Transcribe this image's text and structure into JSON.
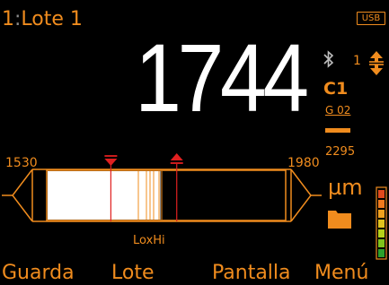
{
  "header": {
    "batch_number": "1",
    "batch_separator": ":",
    "batch_name": "Lote 1",
    "usb_label": "USB"
  },
  "reading": {
    "value": "1744"
  },
  "side_panel": {
    "page_indicator": "1",
    "calibration_label": "C1",
    "calibration_sub": "G 02"
  },
  "scale": {
    "min": "1530",
    "max": "1980",
    "upper_limit": "2295",
    "lo_hi_label": "LoxHi",
    "unit": "µm",
    "current_value": 1744,
    "lower_tolerance_marker": 1650,
    "upper_tolerance_marker": 1775
  },
  "battery": {
    "colors": [
      "#2ca02c",
      "#7fc31c",
      "#b6d11a",
      "#e0c21e",
      "#f0a01e",
      "#f07a1e",
      "#e04a1e"
    ]
  },
  "softkeys": {
    "f1": "Guarda",
    "f2": "Lote",
    "f3": "Pantalla",
    "f4": "Menú"
  },
  "colors": {
    "accent": "#f08c1e",
    "limit_marker": "#e02020",
    "reading": "#ffffff"
  }
}
